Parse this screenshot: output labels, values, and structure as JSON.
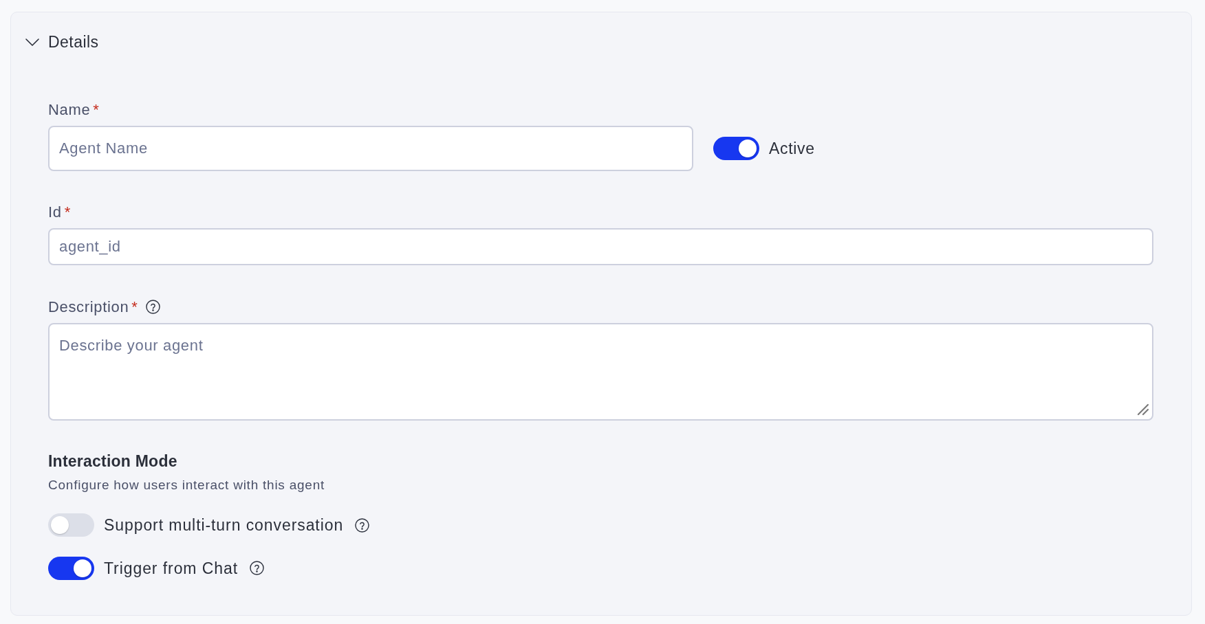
{
  "section": {
    "title": "Details",
    "expanded": true
  },
  "fields": [
    {
      "kind": "input",
      "label": "Name",
      "required_mark": "*",
      "placeholder": "Agent Name",
      "toggle": {
        "label": "Active",
        "on": true
      }
    },
    {
      "kind": "input",
      "label": "Id",
      "required_mark": "*",
      "placeholder": "agent_id"
    },
    {
      "kind": "textarea",
      "label": "Description",
      "required_mark": "*",
      "has_help": true,
      "placeholder": "Describe your agent"
    }
  ],
  "interaction_mode": {
    "title": "Interaction Mode",
    "subtitle": "Configure how users interact with this agent",
    "options": [
      {
        "label": "Support multi-turn conversation",
        "on": false,
        "has_help": true
      },
      {
        "label": "Trigger from Chat",
        "on": true,
        "has_help": true
      }
    ]
  }
}
